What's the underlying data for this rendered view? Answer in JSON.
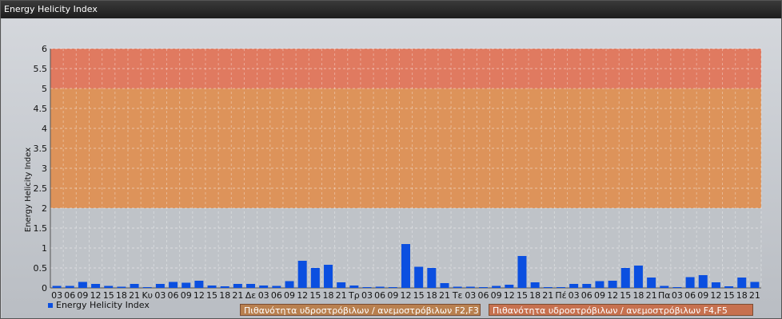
{
  "window": {
    "title": "Energy Helicity Index"
  },
  "colors": {
    "bar": "#0b4fe0",
    "band_high": "#e07a60",
    "band_mid": "#dd935a",
    "band_low_legend": "#b9804f",
    "band_mid_legend": "#c7714f"
  },
  "legend": {
    "series_label": "Energy Helicity Index",
    "band1_label": "Πιθανότητα υδροστρόβιλων / ανεμοστρόβιλων F2,F3",
    "band2_label": "Πιθανότητα υδροστρόβιλων / ανεμοστρόβιλων F4,F5"
  },
  "chart_data": {
    "type": "bar",
    "title": "",
    "ylabel": "Energy Helicity Index",
    "ylim": [
      0,
      6
    ],
    "yticks": [
      "0",
      "0.5",
      "1",
      "1.5",
      "2",
      "2.5",
      "3",
      "3.5",
      "4",
      "4.5",
      "5",
      "5.5",
      "6"
    ],
    "bands": [
      {
        "from": 2,
        "to": 5,
        "name": "Πιθανότητα υδροστρόβιλων / ανεμοστρόβιλων F2,F3"
      },
      {
        "from": 5,
        "to": 6,
        "name": "Πιθανότητα υδροστρόβιλων / ανεμοστρόβιλων F4,F5"
      }
    ],
    "categories": [
      "03",
      "06",
      "09",
      "12",
      "15",
      "18",
      "21",
      "Κυ",
      "03",
      "06",
      "09",
      "12",
      "15",
      "18",
      "21",
      "Δε",
      "03",
      "06",
      "09",
      "12",
      "15",
      "18",
      "21",
      "Τρ",
      "03",
      "06",
      "09",
      "12",
      "15",
      "18",
      "21",
      "Τε",
      "03",
      "06",
      "09",
      "12",
      "15",
      "18",
      "21",
      "Πέ",
      "03",
      "06",
      "09",
      "12",
      "15",
      "18",
      "21",
      "Πα",
      "03",
      "06",
      "09",
      "12",
      "15",
      "18",
      "21"
    ],
    "series": [
      {
        "name": "Energy Helicity Index",
        "values": [
          0.05,
          0.05,
          0.15,
          0.1,
          0.05,
          0.03,
          0.1,
          0.02,
          0.1,
          0.15,
          0.13,
          0.18,
          0.06,
          0.04,
          0.1,
          0.1,
          0.06,
          0.05,
          0.17,
          0.68,
          0.5,
          0.58,
          0.14,
          0.06,
          0.02,
          0.03,
          0.02,
          1.1,
          0.53,
          0.5,
          0.12,
          0.03,
          0.03,
          0.02,
          0.05,
          0.08,
          0.8,
          0.14,
          0.02,
          0.02,
          0.1,
          0.1,
          0.17,
          0.18,
          0.5,
          0.56,
          0.26,
          0.05,
          0.02,
          0.27,
          0.32,
          0.14,
          0.04,
          0.26,
          0.15
        ]
      }
    ],
    "grid": true,
    "legend_position": "bottom-left"
  }
}
